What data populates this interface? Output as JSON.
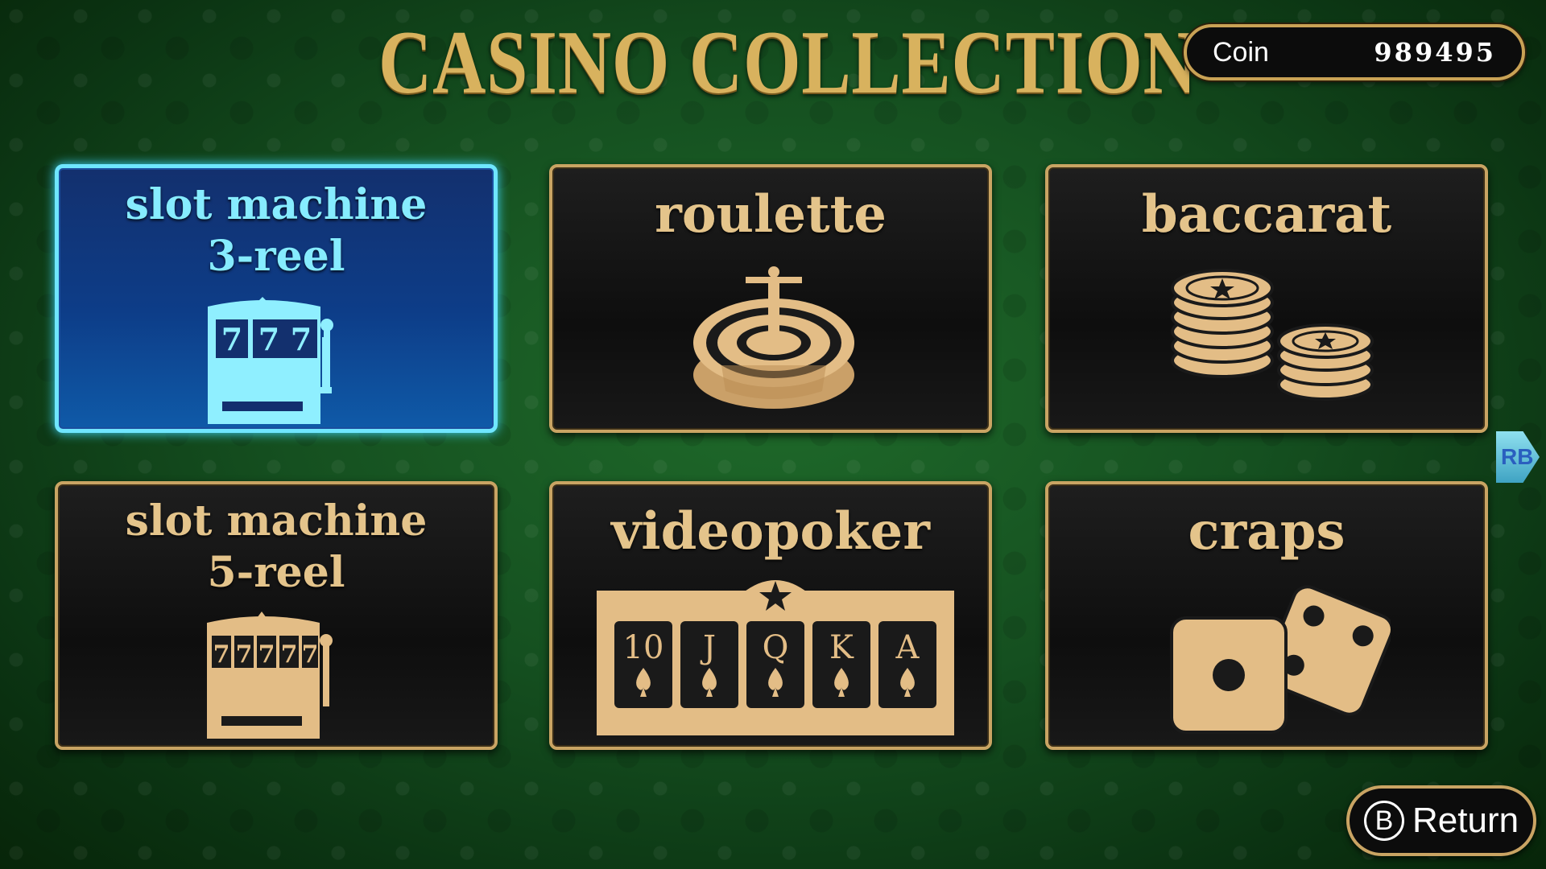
{
  "title": "CASINO COLLECTION",
  "coin": {
    "label": "Coin",
    "value": "989495"
  },
  "games": [
    {
      "line1": "slot machine",
      "line2": "3-reel",
      "icon": "slot-machine-3-icon",
      "reels": [
        "7",
        "7",
        "7"
      ],
      "selected": true
    },
    {
      "line1": "roulette",
      "icon": "roulette-wheel-icon",
      "selected": false
    },
    {
      "line1": "baccarat",
      "icon": "chip-stacks-icon",
      "selected": false
    },
    {
      "line1": "slot machine",
      "line2": "5-reel",
      "icon": "slot-machine-5-icon",
      "reels": [
        "7",
        "7",
        "7",
        "7",
        "7"
      ],
      "selected": false
    },
    {
      "line1": "videopoker",
      "icon": "poker-cards-icon",
      "cards": [
        "10",
        "J",
        "Q",
        "K",
        "A"
      ],
      "selected": false
    },
    {
      "line1": "craps",
      "icon": "dice-icon",
      "selected": false
    }
  ],
  "page_tab": {
    "label": "RB"
  },
  "return_button": {
    "key": "B",
    "label": "Return"
  },
  "colors": {
    "gold": "#d8b25e",
    "selected_accent": "#6fe6ff",
    "felt": "#155020"
  }
}
